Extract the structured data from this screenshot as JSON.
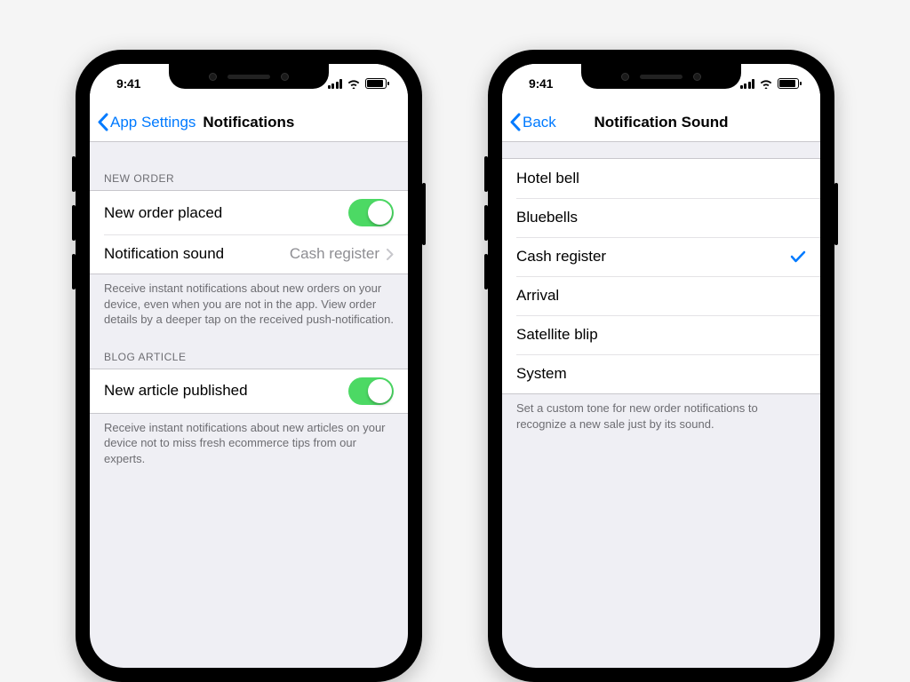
{
  "statusbar": {
    "time": "9:41"
  },
  "colors": {
    "tint": "#007aff",
    "switchOn": "#4cd964"
  },
  "left": {
    "nav": {
      "back": "App Settings",
      "title": "Notifications"
    },
    "sections": {
      "newOrder": {
        "header": "NEW ORDER",
        "row_placed": {
          "label": "New order placed",
          "on": true
        },
        "row_sound": {
          "label": "Notification sound",
          "value": "Cash register"
        },
        "footer": "Receive instant notifications about new orders on your device, even when you are not in the app. View order details by a deeper tap on the received push-notification."
      },
      "blog": {
        "header": "BLOG ARTICLE",
        "row_article": {
          "label": "New article published",
          "on": true
        },
        "footer": "Receive instant notifications about new articles on your device not to miss fresh ecommerce tips from our experts."
      }
    }
  },
  "right": {
    "nav": {
      "back": "Back",
      "title": "Notification Sound"
    },
    "options": [
      {
        "label": "Hotel bell",
        "selected": false
      },
      {
        "label": "Bluebells",
        "selected": false
      },
      {
        "label": "Cash register",
        "selected": true
      },
      {
        "label": "Arrival",
        "selected": false
      },
      {
        "label": "Satellite blip",
        "selected": false
      },
      {
        "label": "System",
        "selected": false
      }
    ],
    "footer": "Set a custom tone for new order notifications to recognize a new sale just by its sound."
  }
}
